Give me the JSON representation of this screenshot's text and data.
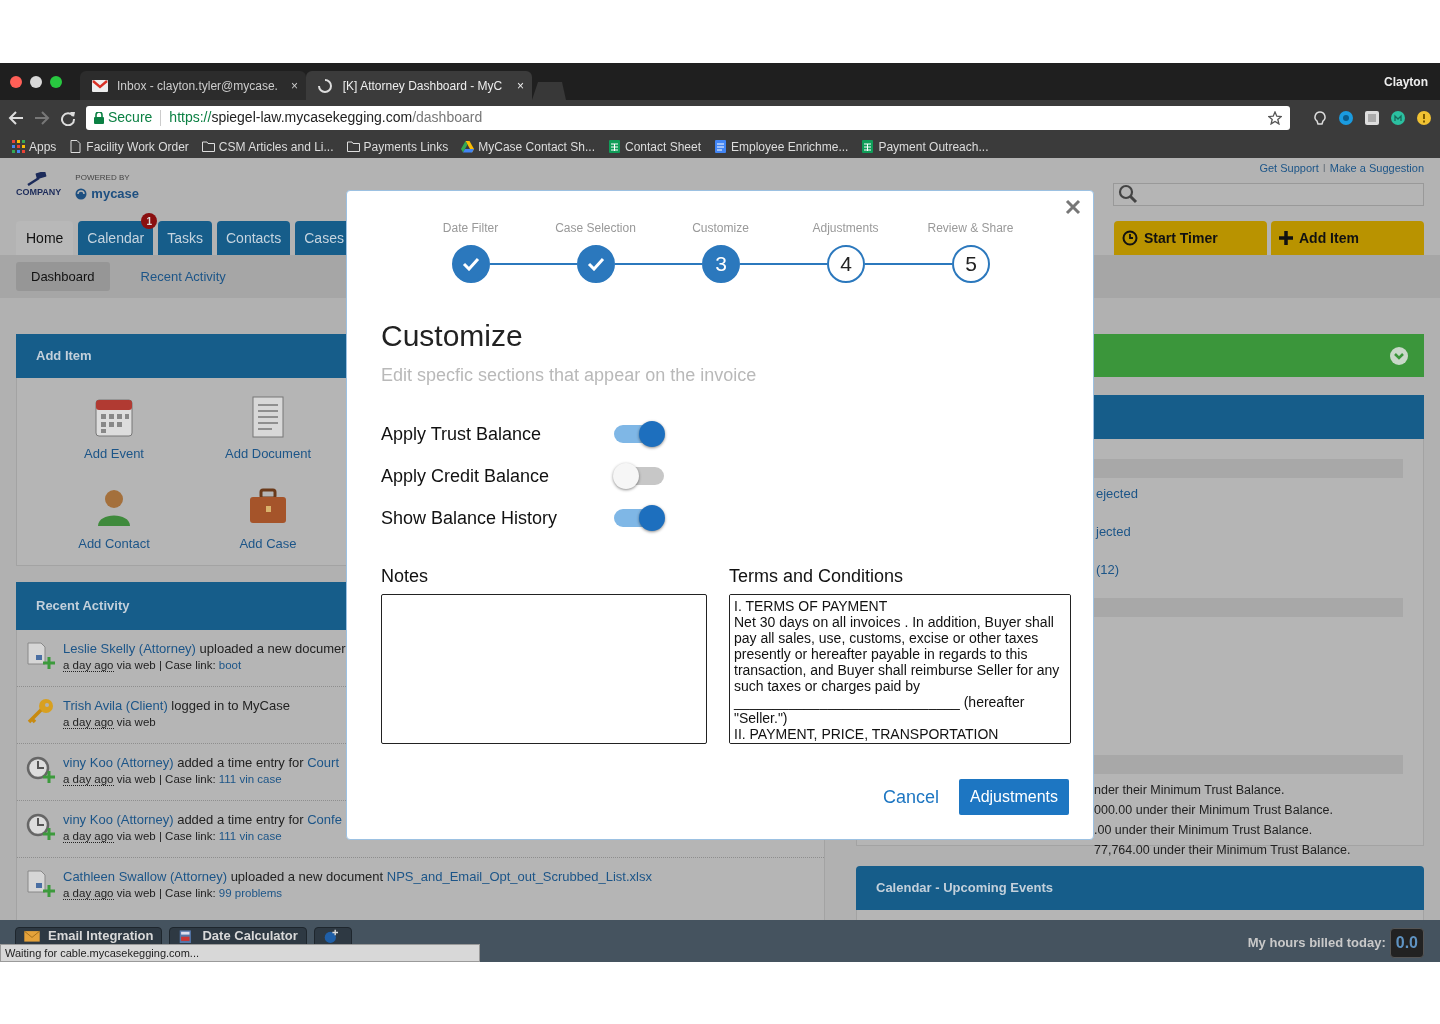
{
  "browser": {
    "user": "Clayton",
    "tabs": [
      {
        "title": "Inbox - clayton.tyler@mycase.",
        "kind": "mail",
        "selected": false,
        "close": "×"
      },
      {
        "title": "[K] Attorney Dashboard - MyC",
        "kind": "loading",
        "selected": true,
        "close": "×"
      }
    ],
    "address": {
      "security": "Secure",
      "scheme": "https://",
      "host": "spiegel-law.mycasekegging.com",
      "path": "/dashboard"
    },
    "bookmarks": [
      {
        "label": "Apps",
        "kind": "apps"
      },
      {
        "label": "Facility Work Order",
        "kind": "page"
      },
      {
        "label": "CSM Articles and Li...",
        "kind": "folder"
      },
      {
        "label": "Payments Links",
        "kind": "folder"
      },
      {
        "label": "MyCase Contact Sh...",
        "kind": "drive"
      },
      {
        "label": "Contact Sheet",
        "kind": "sheet"
      },
      {
        "label": "Employee Enrichme...",
        "kind": "doc"
      },
      {
        "label": "Payment Outreach...",
        "kind": "sheet"
      }
    ]
  },
  "header": {
    "brand": "COMPANY",
    "powered_by": "POWERED BY",
    "product": "mycase",
    "links": [
      "Get Support",
      "Make a Suggestion"
    ],
    "separator": "I",
    "actions": [
      {
        "label": "Start Timer",
        "kind": "timer"
      },
      {
        "label": "Add Item",
        "kind": "plus"
      }
    ]
  },
  "nav": {
    "tabs": [
      {
        "label": "Home",
        "selected": true
      },
      {
        "label": "Calendar",
        "selected": false,
        "badge": "1"
      },
      {
        "label": "Tasks",
        "selected": false
      },
      {
        "label": "Contacts",
        "selected": false
      },
      {
        "label": "Cases",
        "selected": false
      }
    ],
    "subtabs": [
      {
        "label": "Dashboard",
        "selected": true
      },
      {
        "label": "Recent Activity",
        "selected": false
      }
    ]
  },
  "add_item": {
    "title": "Add Item",
    "items": [
      {
        "label": "Add Event",
        "kind": "event"
      },
      {
        "label": "Add Document",
        "kind": "document"
      },
      {
        "label": "Add Contact",
        "kind": "contact"
      },
      {
        "label": "Add Case",
        "kind": "case"
      }
    ]
  },
  "recent_activity": {
    "title": "Recent Activity",
    "rows": [
      {
        "kind": "document",
        "actor": "Leslie Skelly (Attorney)",
        "action": " uploaded a new documer",
        "time": "a day ago",
        "source": " via web ",
        "case_label": "| Case link: ",
        "case": "boot"
      },
      {
        "kind": "login",
        "actor": "Trish Avila (Client)",
        "action": " logged in to MyCase",
        "time": "a day ago",
        "source": " via web"
      },
      {
        "kind": "time",
        "actor": "viny Koo (Attorney)",
        "action": " added a time entry for ",
        "object": "Court",
        "time": "a day ago",
        "source": " via web ",
        "case_label": "| Case link: ",
        "case": "111 vin case"
      },
      {
        "kind": "time",
        "actor": "viny Koo (Attorney)",
        "action": " added a time entry for ",
        "object": "Confe",
        "time": "a day ago",
        "source": " via web ",
        "case_label": "| Case link: ",
        "case": "111 vin case"
      },
      {
        "kind": "document",
        "actor": "Cathleen Swallow (Attorney)",
        "action": " uploaded a new document ",
        "object": "NPS_and_Email_Opt_out_Scrubbed_List.xlsx",
        "time": "a day ago",
        "source": " via web ",
        "case_label": "| Case link: ",
        "case": "99 problems"
      }
    ]
  },
  "alerts": {
    "rows": [
      {
        "kind": "stripe"
      },
      {
        "kind": "link",
        "text": "ejected"
      },
      {
        "kind": "link",
        "text": "jected"
      },
      {
        "kind": "link",
        "text": "(12)"
      },
      {
        "kind": "stripe"
      },
      {
        "kind": "stripe"
      },
      {
        "kind": "text",
        "text": "nder their Minimum Trust Balance."
      },
      {
        "kind": "text",
        "text": "000.00 under their Minimum Trust Balance."
      },
      {
        "kind": "text",
        "text": ".00 under their Minimum Trust Balance."
      },
      {
        "kind": "text",
        "text": "77,764.00 under their Minimum Trust Balance."
      }
    ]
  },
  "calendar_panel": {
    "title": "Calendar - Upcoming Events"
  },
  "footer": {
    "buttons": [
      {
        "label": "Email Integration",
        "kind": "mail"
      },
      {
        "label": "Date Calculator",
        "kind": "calc"
      },
      {
        "kind": "add"
      }
    ],
    "hours_label": "My hours billed today:",
    "hours": "0.0"
  },
  "status": "Waiting for cable.mycasekegging.com...",
  "modal": {
    "steps": [
      {
        "label": "Date Filter",
        "kind": "done"
      },
      {
        "label": "Case Selection",
        "kind": "done"
      },
      {
        "label": "Customize",
        "number": "3",
        "kind": "current"
      },
      {
        "label": "Adjustments",
        "number": "4",
        "kind": "todo"
      },
      {
        "label": "Review & Share",
        "number": "5",
        "kind": "todo"
      }
    ],
    "title": "Customize",
    "subtitle": "Edit specfic sections that appear on the invoice",
    "toggles": [
      {
        "label": "Apply Trust Balance",
        "on": true
      },
      {
        "label": "Apply Credit Balance",
        "on": false
      },
      {
        "label": "Show Balance History",
        "on": true
      }
    ],
    "notes": {
      "label": "Notes"
    },
    "terms": {
      "label": "Terms and Conditions",
      "value": "I. TERMS OF PAYMENT\nNet 30 days on all invoices . In addition, Buyer shall pay all sales, use, customs, excise or other taxes presently or hereafter payable in regards to this transaction, and Buyer shall reimburse Seller for any such taxes or charges paid by\n_____________________________ (hereafter \"Seller.\")\nII. PAYMENT, PRICE, TRANSPORTATION"
    },
    "buttons": [
      {
        "label": "Cancel",
        "kind": "link"
      },
      {
        "label": "Adjustments",
        "kind": "primary"
      }
    ]
  }
}
